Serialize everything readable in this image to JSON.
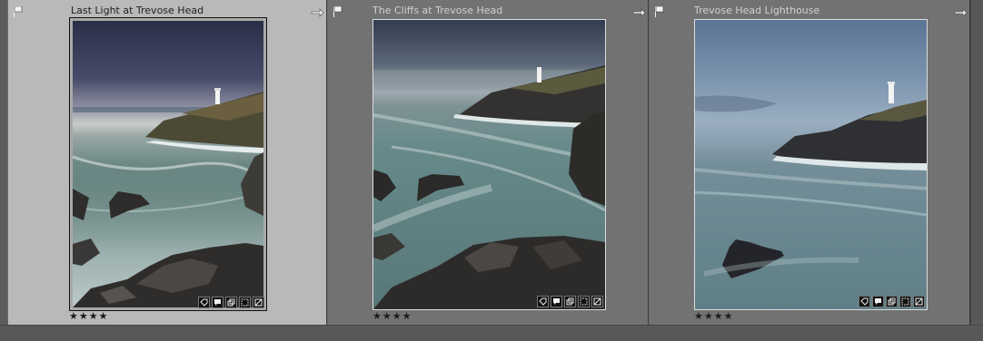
{
  "cells": [
    {
      "title": "Last Light at Trevose Head",
      "rating": "★★★★",
      "selected": true
    },
    {
      "title": "The Cliffs at Trevose Head",
      "rating": "★★★★",
      "selected": false
    },
    {
      "title": "Trevose Head Lighthouse",
      "rating": "★★★★",
      "selected": false
    }
  ],
  "icons": [
    "flag-icon",
    "rotate-icon",
    "keyword-tag-icon",
    "comment-icon",
    "virtual-copy-icon",
    "crop-icon",
    "develop-adjust-icon"
  ],
  "colors": {
    "selected_cell": "#b9b9b9",
    "unselected_cell": "#727272",
    "background": "#585858"
  }
}
